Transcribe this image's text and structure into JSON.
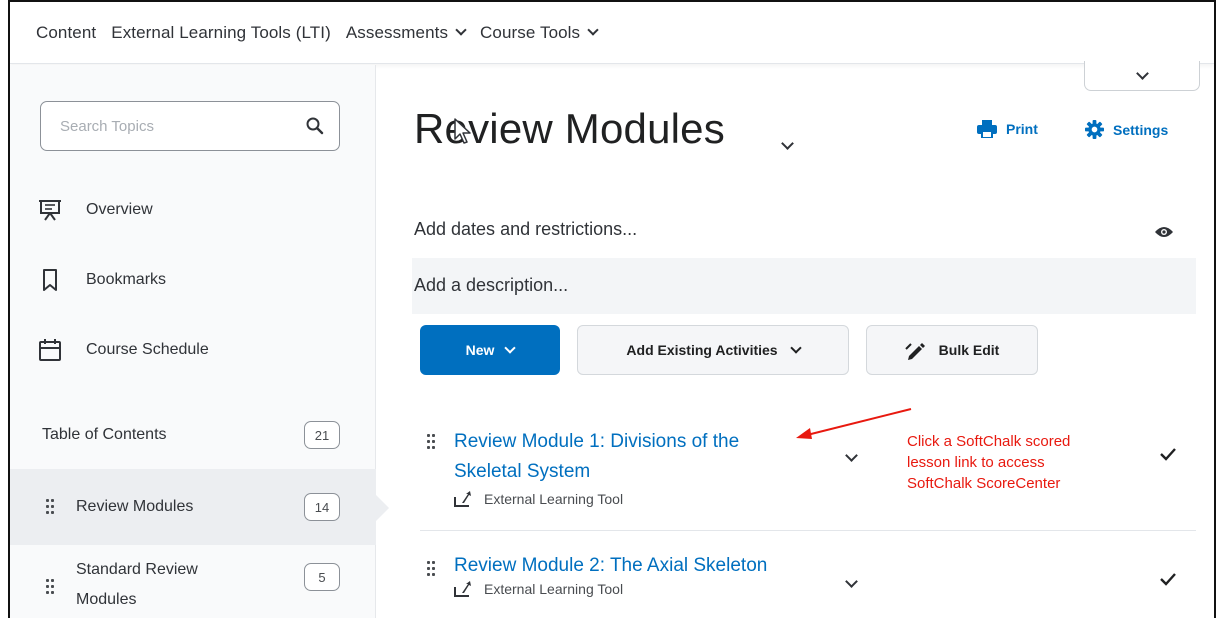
{
  "topnav": {
    "items": [
      {
        "label": "Content"
      },
      {
        "label": "External Learning Tools (LTI)"
      },
      {
        "label": "Assessments"
      },
      {
        "label": "Course Tools"
      }
    ]
  },
  "sidebar": {
    "search_placeholder": "Search Topics",
    "links": [
      {
        "label": "Overview",
        "icon": "presentation-icon"
      },
      {
        "label": "Bookmarks",
        "icon": "bookmark-icon"
      },
      {
        "label": "Course Schedule",
        "icon": "calendar-icon"
      }
    ],
    "toc": {
      "label": "Table of Contents",
      "count": "21"
    },
    "modules": [
      {
        "label": "Review Modules",
        "count": "14",
        "active": true
      },
      {
        "label": "Standard Review Modules",
        "label_line1": "Standard Review",
        "label_line2": "Modules",
        "count": "5"
      }
    ]
  },
  "main": {
    "title": "Review Modules",
    "print_label": "Print",
    "settings_label": "Settings",
    "dates_label": "Add dates and restrictions...",
    "description_label": "Add a description...",
    "buttons": {
      "new": "New",
      "add_existing": "Add Existing Activities",
      "bulk_edit": "Bulk Edit"
    },
    "items": [
      {
        "title_line1": "Review Module 1: Divisions of the",
        "title_line2": "Skeletal System",
        "type": "External Learning Tool"
      },
      {
        "title_line1": "Review Module 2: The Axial Skeleton",
        "type": "External Learning Tool"
      }
    ],
    "annotation": {
      "line1": "Click a SoftChalk scored",
      "line2": "lesson link  to access",
      "line3": "SoftChalk ScoreCenter"
    }
  },
  "colors": {
    "accent": "#006fbf",
    "annotation": "#e8190f",
    "sidebar_bg": "#f9fafb"
  }
}
